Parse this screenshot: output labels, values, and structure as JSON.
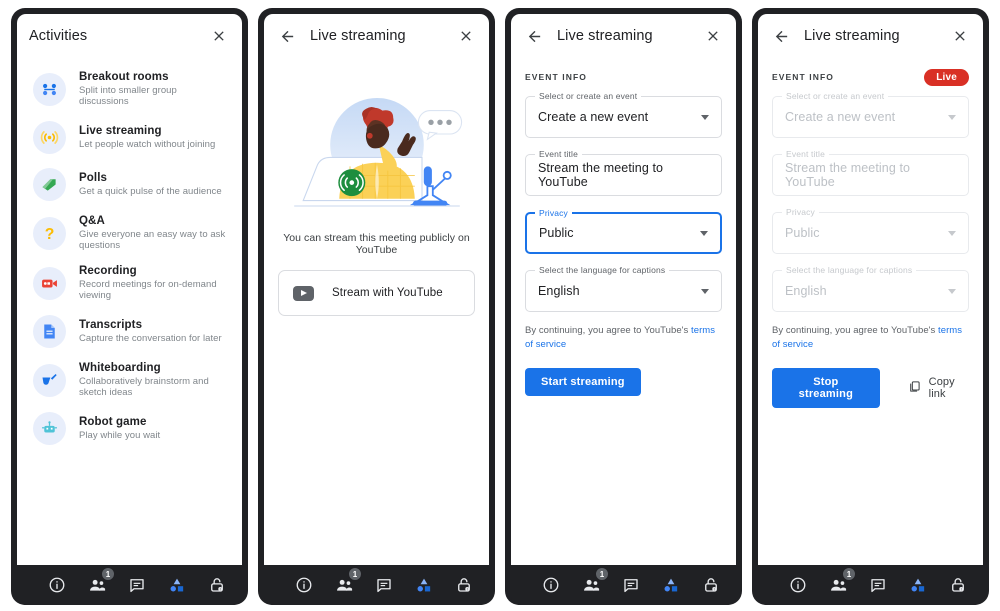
{
  "panels": [
    {
      "id": "activities",
      "header": {
        "title": "Activities",
        "has_back": false,
        "close_icon": "close-icon"
      },
      "activities": [
        {
          "title": "Breakout rooms",
          "subtitle": "Split into smaller group discussions",
          "icon": "breakout-rooms-icon"
        },
        {
          "title": "Live streaming",
          "subtitle": "Let people watch without joining",
          "icon": "live-streaming-icon"
        },
        {
          "title": "Polls",
          "subtitle": "Get a quick pulse of the audience",
          "icon": "polls-icon"
        },
        {
          "title": "Q&A",
          "subtitle": "Give everyone an easy way to ask questions",
          "icon": "qa-icon"
        },
        {
          "title": "Recording",
          "subtitle": "Record meetings for on-demand viewing",
          "icon": "recording-icon"
        },
        {
          "title": "Transcripts",
          "subtitle": "Capture the conversation for later",
          "icon": "transcripts-icon"
        },
        {
          "title": "Whiteboarding",
          "subtitle": "Collaboratively brainstorm and sketch ideas",
          "icon": "whiteboarding-icon"
        },
        {
          "title": "Robot game",
          "subtitle": "Play while you wait",
          "icon": "robot-game-icon"
        }
      ]
    },
    {
      "id": "stream-intro",
      "header": {
        "title": "Live streaming",
        "has_back": true,
        "back_icon": "arrow-back-icon",
        "close_icon": "close-icon"
      },
      "illustration": "live-streaming-illustration",
      "caption": "You can stream this meeting publicly on YouTube",
      "stream_button": {
        "label": "Stream with YouTube",
        "icon": "youtube-icon"
      }
    },
    {
      "id": "stream-setup",
      "header": {
        "title": "Live streaming",
        "has_back": true,
        "back_icon": "arrow-back-icon",
        "close_icon": "close-icon"
      },
      "section_title": "EVENT INFO",
      "fields": [
        {
          "label": "Select or create an event",
          "value": "Create a new event",
          "type": "select",
          "focused": false,
          "disabled": false
        },
        {
          "label": "Event title",
          "value": "Stream the meeting to YouTube",
          "type": "text",
          "focused": false,
          "disabled": false
        },
        {
          "label": "Privacy",
          "value": "Public",
          "type": "select",
          "focused": true,
          "disabled": false
        },
        {
          "label": "Select the language for captions",
          "value": "English",
          "type": "select",
          "focused": false,
          "disabled": false
        }
      ],
      "terms_prefix": "By continuing, you agree to YouTube's ",
      "terms_link": "terms of service",
      "primary_button": "Start streaming"
    },
    {
      "id": "stream-live",
      "header": {
        "title": "Live streaming",
        "has_back": true,
        "back_icon": "arrow-back-icon",
        "close_icon": "close-icon"
      },
      "section_title": "EVENT INFO",
      "badge": "Live",
      "fields": [
        {
          "label": "Select or create an event",
          "value": "Create a new event",
          "type": "select",
          "focused": false,
          "disabled": true
        },
        {
          "label": "Event title",
          "value": "Stream the meeting to YouTube",
          "type": "text",
          "focused": false,
          "disabled": true
        },
        {
          "label": "Privacy",
          "value": "Public",
          "type": "select",
          "focused": false,
          "disabled": true
        },
        {
          "label": "Select the language for captions",
          "value": "English",
          "type": "select",
          "focused": false,
          "disabled": true
        }
      ],
      "terms_prefix": "By continuing, you agree to YouTube's ",
      "terms_link": "terms of service",
      "primary_button": "Stop streaming",
      "copy_link": {
        "label": "Copy link",
        "icon": "copy-icon"
      }
    }
  ],
  "toolbar": {
    "items": [
      {
        "name": "meeting-details",
        "icon": "info-icon",
        "badge": null
      },
      {
        "name": "people",
        "icon": "people-icon",
        "badge": "1"
      },
      {
        "name": "chat",
        "icon": "chat-icon",
        "badge": null
      },
      {
        "name": "activities",
        "icon": "activities-icon",
        "badge": null
      },
      {
        "name": "host-controls",
        "icon": "host-controls-icon",
        "badge": null
      }
    ]
  },
  "colors": {
    "accent": "#1a73e8",
    "live_red": "#d93025",
    "frame": "#202124",
    "text_primary": "#202124",
    "text_secondary": "#5f6368",
    "border": "#dadce0"
  }
}
